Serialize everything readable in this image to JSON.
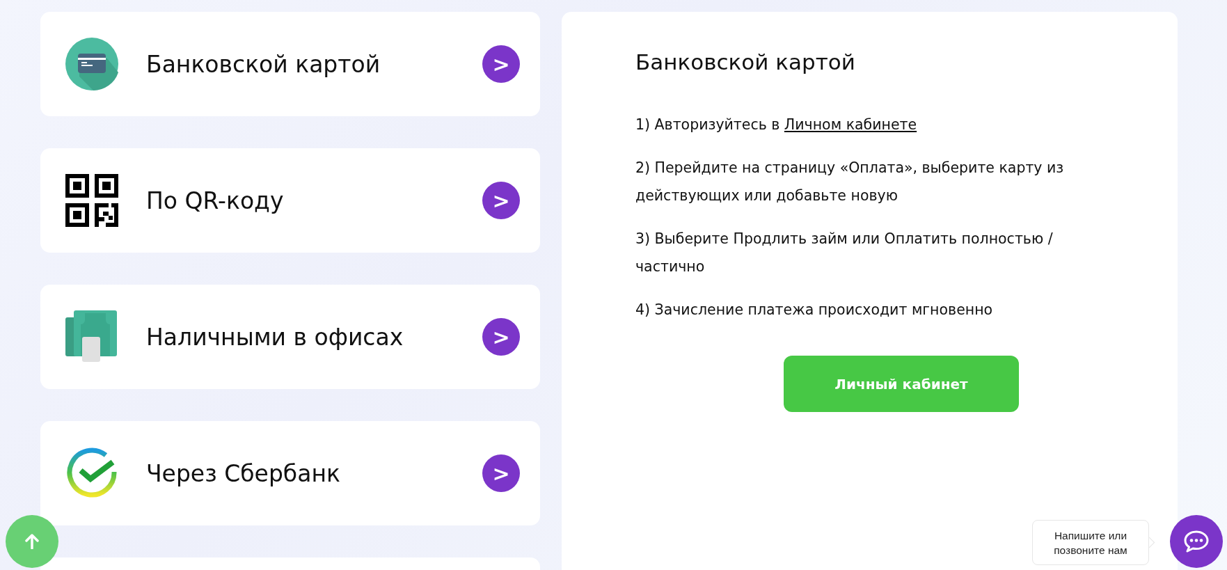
{
  "methods": [
    {
      "kind": "card",
      "label": "Банковской картой",
      "arrow": ">"
    },
    {
      "kind": "qr",
      "label": "По QR-коду",
      "arrow": ">"
    },
    {
      "kind": "cash",
      "label": "Наличными в офисах",
      "arrow": ">"
    },
    {
      "kind": "sber",
      "label": "Через Сбербанк",
      "arrow": ">"
    }
  ],
  "panel": {
    "title": "Банковской картой",
    "steps": [
      {
        "text": "1) Авторизуйтесь в ",
        "link": "Личном кабинете"
      },
      {
        "text": "2) Перейдите на страницу «Оплата», выберите карту из действующих или добавьте новую"
      },
      {
        "text": "3) Выберите Продлить займ или Оплатить полностью / частично"
      },
      {
        "text": "4) Зачисление платежа происходит мгновенно"
      }
    ],
    "button": "Личный кабинет"
  },
  "chat_tooltip": "Напишите или позвоните нам"
}
